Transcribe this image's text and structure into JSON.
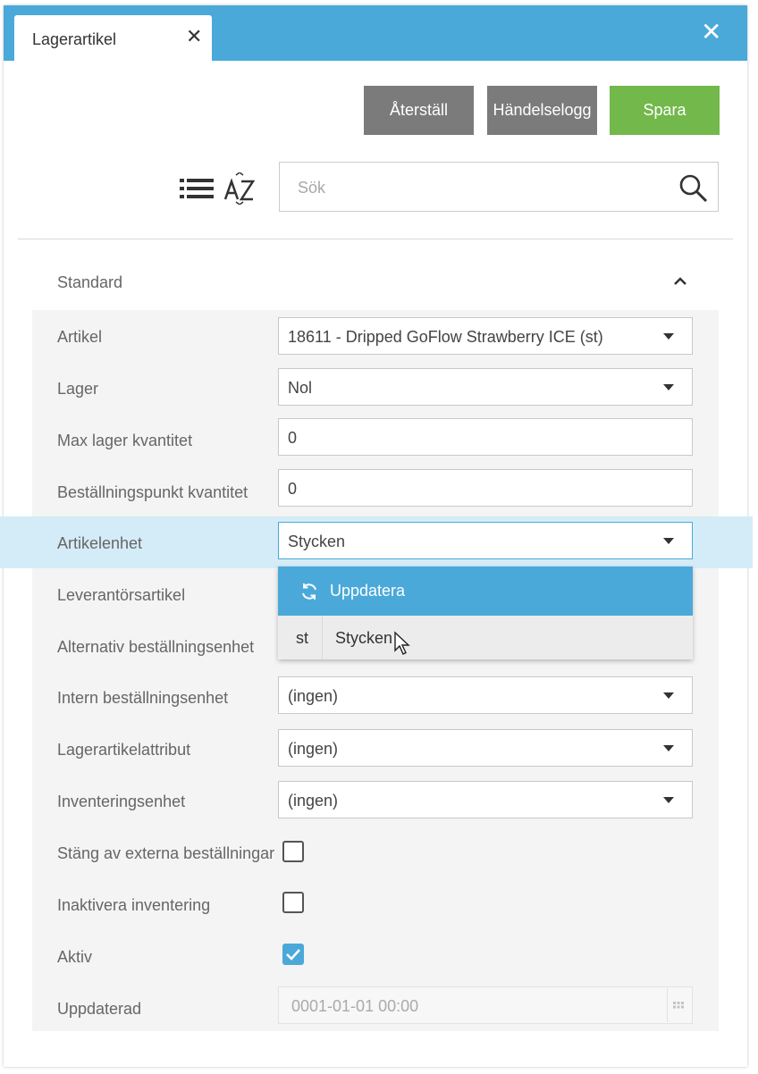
{
  "window": {
    "tab_title": "Lagerartikel",
    "tab_close": "✕",
    "close": "✕"
  },
  "toolbar": {
    "reset_label": "Återställ",
    "log_label": "Händelselogg",
    "save_label": "Spara"
  },
  "search": {
    "placeholder": "Sök"
  },
  "panel": {
    "title": "Standard"
  },
  "fields": {
    "artikel": {
      "label": "Artikel",
      "value": "18611 - Dripped GoFlow Strawberry ICE (st)"
    },
    "lager": {
      "label": "Lager",
      "value": "Nol"
    },
    "max_lager": {
      "label": "Max lager kvantitet",
      "value": "0"
    },
    "bestallningspunkt": {
      "label": "Beställningspunkt kvantitet",
      "value": "0"
    },
    "artikelenhet": {
      "label": "Artikelenhet",
      "value": "Stycken"
    },
    "leverantorsartikel": {
      "label": "Leverantörsartikel"
    },
    "alt_bestallningsenhet": {
      "label": "Alternativ beställningsenhet"
    },
    "intern_bestallningsenhet": {
      "label": "Intern beställningsenhet",
      "value": "(ingen)"
    },
    "lagerartikelattribut": {
      "label": "Lagerartikelattribut",
      "value": "(ingen)"
    },
    "inventeringsenhet": {
      "label": "Inventeringsenhet",
      "value": "(ingen)"
    },
    "stang_av": {
      "label": "Stäng av externa beställningar",
      "checked": false
    },
    "inaktivera": {
      "label": "Inaktivera inventering",
      "checked": false
    },
    "aktiv": {
      "label": "Aktiv",
      "checked": true
    },
    "uppdaterad": {
      "label": "Uppdaterad",
      "value": "0001-01-01 00:00"
    }
  },
  "dropdown": {
    "refresh_label": "Uppdatera",
    "options": [
      {
        "code": "st",
        "name": "Stycken"
      }
    ]
  },
  "colors": {
    "accent": "#4aa9d9",
    "save": "#72b84b",
    "neutral_button": "#7b7b7b",
    "highlight_row": "#d4ecf7"
  }
}
